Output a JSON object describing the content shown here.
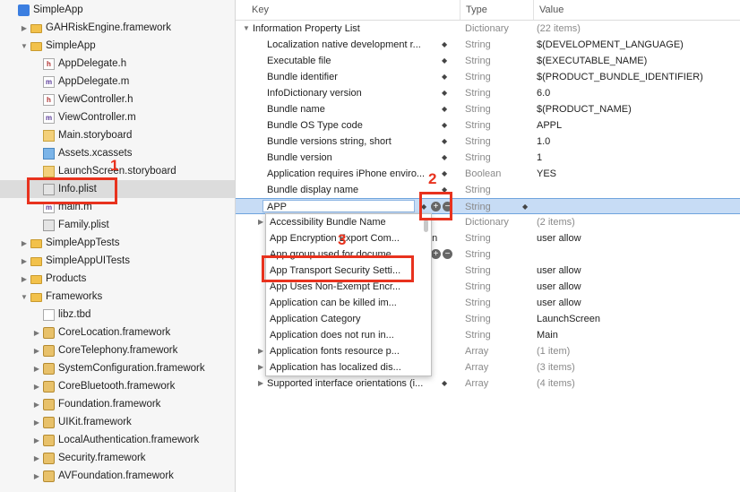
{
  "navigator": {
    "items": [
      {
        "label": "SimpleApp",
        "indent": 0,
        "icon": "proj",
        "disc": "",
        "name": "project-icon"
      },
      {
        "label": "GAHRiskEngine.framework",
        "indent": 1,
        "icon": "folder",
        "disc": "▶",
        "name": "folder-icon"
      },
      {
        "label": "SimpleApp",
        "indent": 1,
        "icon": "folder",
        "disc": "▼",
        "name": "folder-icon"
      },
      {
        "label": "AppDelegate.h",
        "indent": 2,
        "icon": "fh",
        "disc": "",
        "name": "header-file-icon",
        "glyph": "h"
      },
      {
        "label": "AppDelegate.m",
        "indent": 2,
        "icon": "fm",
        "disc": "",
        "name": "source-file-icon",
        "glyph": "m"
      },
      {
        "label": "ViewController.h",
        "indent": 2,
        "icon": "fh",
        "disc": "",
        "name": "header-file-icon",
        "glyph": "h"
      },
      {
        "label": "ViewController.m",
        "indent": 2,
        "icon": "fm",
        "disc": "",
        "name": "source-file-icon",
        "glyph": "m"
      },
      {
        "label": "Main.storyboard",
        "indent": 2,
        "icon": "sb",
        "disc": "",
        "name": "storyboard-icon"
      },
      {
        "label": "Assets.xcassets",
        "indent": 2,
        "icon": "xa",
        "disc": "",
        "name": "assets-icon"
      },
      {
        "label": "LaunchScreen.storyboard",
        "indent": 2,
        "icon": "sb",
        "disc": "",
        "name": "storyboard-icon"
      },
      {
        "label": "Info.plist",
        "indent": 2,
        "icon": "pl",
        "disc": "",
        "name": "plist-file-icon",
        "selected": true
      },
      {
        "label": "main.m",
        "indent": 2,
        "icon": "fm",
        "disc": "",
        "name": "source-file-icon",
        "glyph": "m"
      },
      {
        "label": "Family.plist",
        "indent": 2,
        "icon": "pl",
        "disc": "",
        "name": "plist-file-icon"
      },
      {
        "label": "SimpleAppTests",
        "indent": 1,
        "icon": "folder",
        "disc": "▶",
        "name": "folder-icon"
      },
      {
        "label": "SimpleAppUITests",
        "indent": 1,
        "icon": "folder",
        "disc": "▶",
        "name": "folder-icon"
      },
      {
        "label": "Products",
        "indent": 1,
        "icon": "folder",
        "disc": "▶",
        "name": "folder-icon"
      },
      {
        "label": "Frameworks",
        "indent": 1,
        "icon": "folder",
        "disc": "▼",
        "name": "folder-icon"
      },
      {
        "label": "libz.tbd",
        "indent": 2,
        "icon": "tbd",
        "disc": "",
        "name": "library-file-icon"
      },
      {
        "label": "CoreLocation.framework",
        "indent": 2,
        "icon": "fw",
        "disc": "▶",
        "name": "framework-icon"
      },
      {
        "label": "CoreTelephony.framework",
        "indent": 2,
        "icon": "fw",
        "disc": "▶",
        "name": "framework-icon"
      },
      {
        "label": "SystemConfiguration.framework",
        "indent": 2,
        "icon": "fw",
        "disc": "▶",
        "name": "framework-icon"
      },
      {
        "label": "CoreBluetooth.framework",
        "indent": 2,
        "icon": "fw",
        "disc": "▶",
        "name": "framework-icon"
      },
      {
        "label": "Foundation.framework",
        "indent": 2,
        "icon": "fw",
        "disc": "▶",
        "name": "framework-icon"
      },
      {
        "label": "UIKit.framework",
        "indent": 2,
        "icon": "fw",
        "disc": "▶",
        "name": "framework-icon"
      },
      {
        "label": "LocalAuthentication.framework",
        "indent": 2,
        "icon": "fw",
        "disc": "▶",
        "name": "framework-icon"
      },
      {
        "label": "Security.framework",
        "indent": 2,
        "icon": "fw",
        "disc": "▶",
        "name": "framework-icon"
      },
      {
        "label": "AVFoundation.framework",
        "indent": 2,
        "icon": "fw",
        "disc": "▶",
        "name": "framework-icon"
      }
    ]
  },
  "plist": {
    "headers": {
      "key": "Key",
      "type": "Type",
      "value": "Value"
    },
    "rows": [
      {
        "key": "Information Property List",
        "type": "Dictionary",
        "value": "(22 items)",
        "root": true,
        "disc": "▼",
        "muted": true
      },
      {
        "key": "Localization native development r...",
        "type": "String",
        "value": "$(DEVELOPMENT_LANGUAGE)",
        "stepper": true
      },
      {
        "key": "Executable file",
        "type": "String",
        "value": "$(EXECUTABLE_NAME)",
        "stepper": true
      },
      {
        "key": "Bundle identifier",
        "type": "String",
        "value": "$(PRODUCT_BUNDLE_IDENTIFIER)",
        "stepper": true
      },
      {
        "key": "InfoDictionary version",
        "type": "String",
        "value": "6.0",
        "stepper": true
      },
      {
        "key": "Bundle name",
        "type": "String",
        "value": "$(PRODUCT_NAME)",
        "stepper": true
      },
      {
        "key": "Bundle OS Type code",
        "type": "String",
        "value": "APPL",
        "stepper": true
      },
      {
        "key": "Bundle versions string, short",
        "type": "String",
        "value": "1.0",
        "stepper": true
      },
      {
        "key": "Bundle version",
        "type": "String",
        "value": "1",
        "stepper": true
      },
      {
        "key": "Application requires iPhone enviro...",
        "type": "Boolean",
        "value": "YES",
        "stepper": true
      },
      {
        "key": "Bundle display name",
        "type": "String",
        "value": "",
        "stepper": true
      },
      {
        "key": "",
        "type": "String",
        "value": "",
        "edit": true
      },
      {
        "key": "",
        "type": "Dictionary",
        "value": "(2 items)",
        "disc": "▶",
        "muted": true
      },
      {
        "key": "on",
        "type": "String",
        "value": "user allow",
        "partial": true
      },
      {
        "key": "",
        "type": "String",
        "value": "",
        "pm": true
      },
      {
        "key": "",
        "type": "String",
        "value": "user allow"
      },
      {
        "key": "",
        "type": "String",
        "value": "user allow"
      },
      {
        "key": "",
        "type": "String",
        "value": "user allow"
      },
      {
        "key": "",
        "type": "String",
        "value": "LaunchScreen"
      },
      {
        "key": "",
        "type": "String",
        "value": "Main"
      },
      {
        "key": "",
        "type": "Array",
        "value": "(1 item)",
        "disc": "▶",
        "muted": true
      },
      {
        "key": "",
        "type": "Array",
        "value": "(3 items)",
        "disc": "▶",
        "muted": true
      },
      {
        "key": "Supported interface orientations (i...",
        "type": "Array",
        "value": "(4 items)",
        "disc": "▶",
        "muted": true,
        "stepper": true
      }
    ],
    "edit_value": "APP"
  },
  "dropdown": {
    "items": [
      "Accessibility Bundle Name",
      "App Encryption Export Com...",
      "App group used for docume...",
      "App Transport Security Setti...",
      "App Uses Non-Exempt Encr...",
      "Application can be killed im...",
      "Application Category",
      "Application does not run in...",
      "Application fonts resource p...",
      "Application has localized dis..."
    ]
  },
  "annotations": {
    "one": "1",
    "two": "2",
    "three": "3"
  },
  "colors": {
    "annotation": "#e8321e",
    "selection": "#c7dcf5"
  }
}
